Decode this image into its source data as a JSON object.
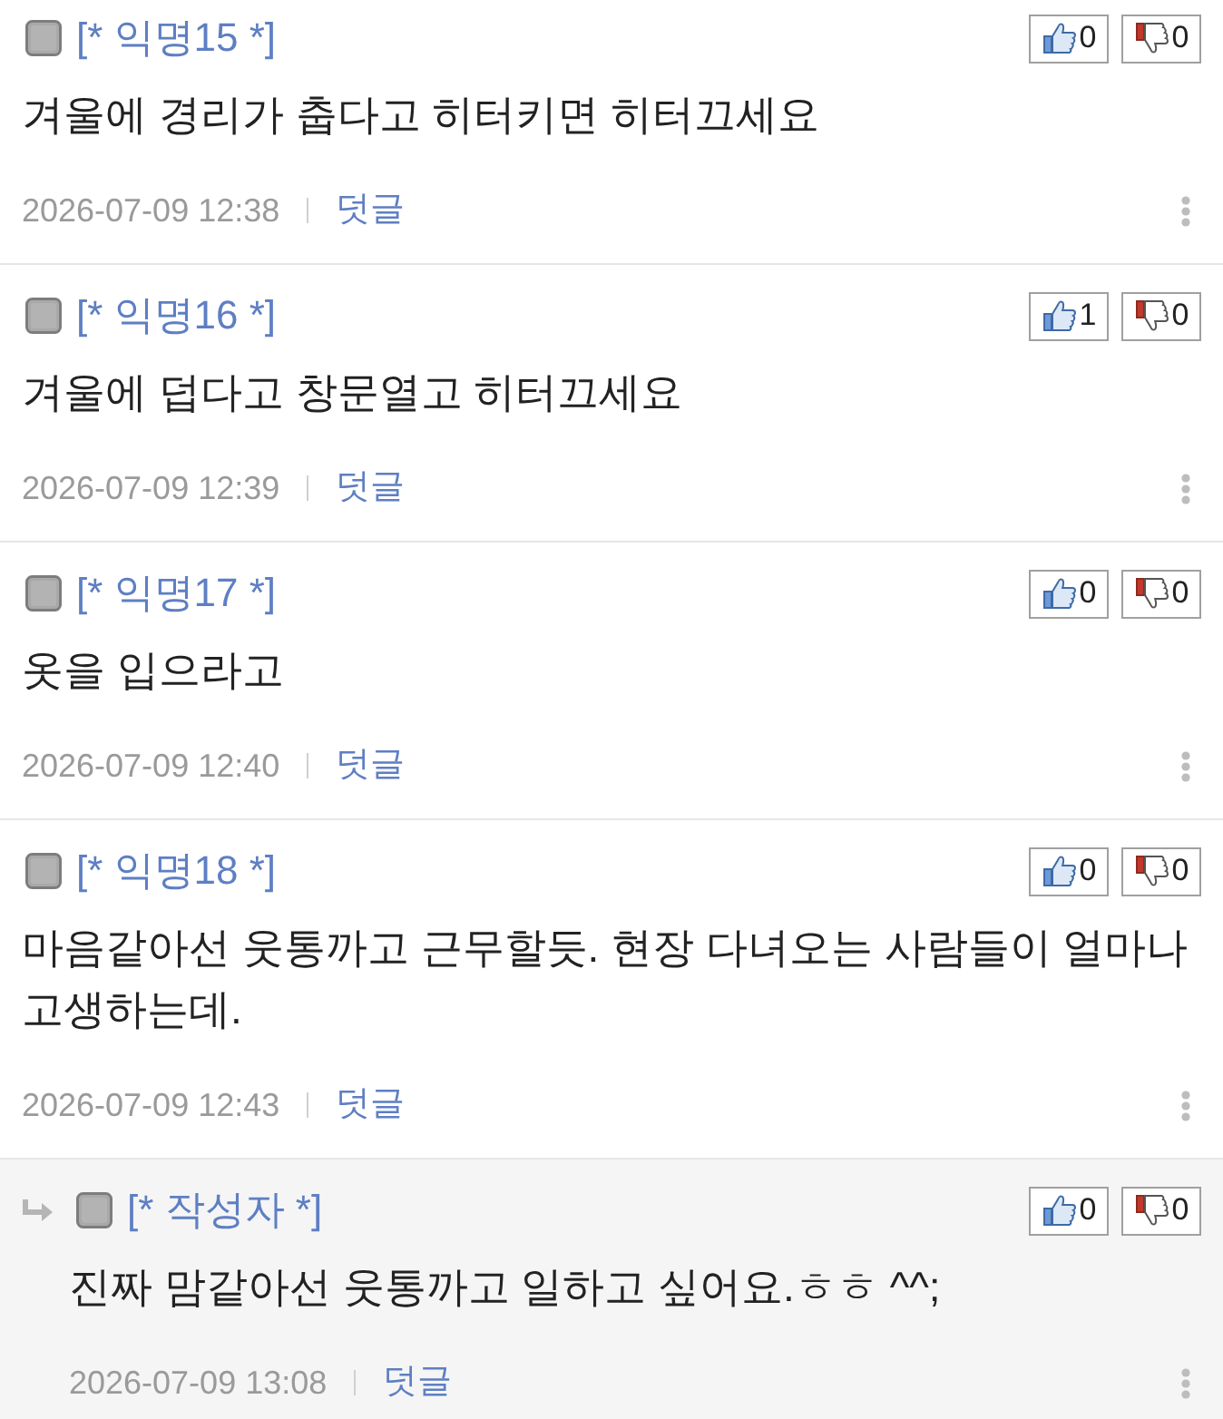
{
  "comments": [
    {
      "kind": "comment",
      "author": "[* 익명15 *]",
      "text": "겨울에 경리가 춥다고 히터키면 히터끄세요",
      "date": "2026-07-09 12:38",
      "reply_label": "덧글",
      "likes": "0",
      "dislikes": "0"
    },
    {
      "kind": "comment",
      "author": "[* 익명16 *]",
      "text": "겨울에 덥다고 창문열고 히터끄세요",
      "date": "2026-07-09 12:39",
      "reply_label": "덧글",
      "likes": "1",
      "dislikes": "0"
    },
    {
      "kind": "comment",
      "author": "[* 익명17 *]",
      "text": "옷을 입으라고",
      "date": "2026-07-09 12:40",
      "reply_label": "덧글",
      "likes": "0",
      "dislikes": "0"
    },
    {
      "kind": "comment",
      "author": "[* 익명18 *]",
      "text": "마음같아선 웃통까고 근무할듯. 현장 다녀오는 사람들이 얼마나 고생하는데.",
      "date": "2026-07-09 12:43",
      "reply_label": "덧글",
      "likes": "0",
      "dislikes": "0"
    },
    {
      "kind": "reply",
      "author": "[* 작성자 *]",
      "text": "진짜 맘같아선 웃통까고 일하고 싶어요.ㅎㅎ ^^;",
      "date": "2026-07-09 13:08",
      "reply_label": "덧글",
      "likes": "0",
      "dislikes": "0"
    }
  ]
}
